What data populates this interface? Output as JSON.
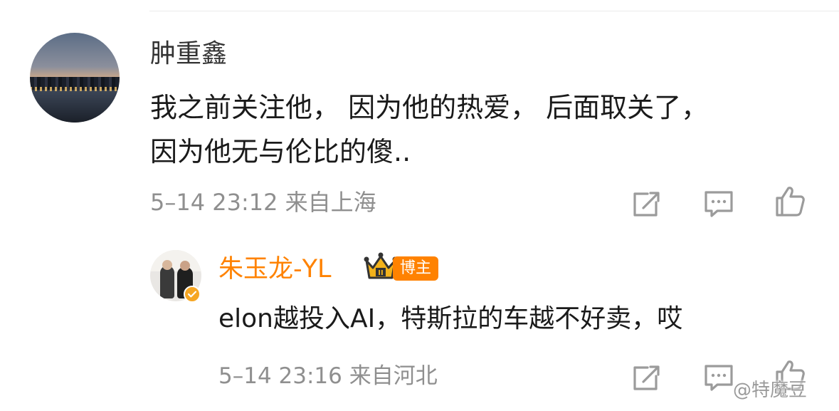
{
  "comment": {
    "author": "肿重鑫",
    "text_line1": "我之前关注他， 因为他的热爱， 后面取关了，",
    "text_line2": "因为他无与伦比的傻..",
    "meta": "5–14 23:12 来自上海"
  },
  "reply": {
    "author": "朱玉龙-YL",
    "role_badge": "博主",
    "crown_level": "II",
    "text": "elon越投入AI，特斯拉的车越不好卖，哎",
    "meta": "5–14 23:16 来自河北"
  },
  "watermark": "@特魔豆",
  "colors": {
    "brand_orange": "#ff8200",
    "meta_gray": "#8f8f8f",
    "icon_gray": "#9b9b9b"
  },
  "icons": {
    "repost": "repost-icon",
    "comment": "comment-icon",
    "like": "like-icon"
  }
}
